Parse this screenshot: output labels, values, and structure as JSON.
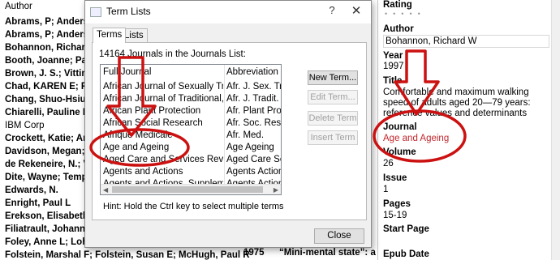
{
  "background_list": {
    "header": "Author",
    "rows": [
      {
        "text": "Abrams, P; Andersso",
        "bold": true
      },
      {
        "text": "Abrams, P; Anders",
        "bold": true
      },
      {
        "text": "Bohannon, Richard W",
        "bold": true
      },
      {
        "text": "Booth, Joanne; Paul,",
        "bold": true
      },
      {
        "text": "Brown, J. S.; Vittingh",
        "bold": true
      },
      {
        "text": "Chad, KAREN E; Reed",
        "bold": true
      },
      {
        "text": "Chang, Shuo-Hsiu J; N",
        "bold": true
      },
      {
        "text": "Chiarelli, Pauline E; M",
        "bold": true
      },
      {
        "text": "IBM Corp",
        "bold": false
      },
      {
        "text": "Crockett, Katie; Arde",
        "bold": true
      },
      {
        "text": "Davidson, Megan; de",
        "bold": true
      },
      {
        "text": "de Rekeneire, N.; Vis",
        "bold": true
      },
      {
        "text": "Dite, Wayne; Temple",
        "bold": true
      },
      {
        "text": "Edwards, N.",
        "bold": true
      },
      {
        "text": "Enright, Paul L",
        "bold": true
      },
      {
        "text": "Erekson, Elisabeth A;",
        "bold": true
      },
      {
        "text": "Filiatrault, Johanne; C",
        "bold": true
      },
      {
        "text": "Foley, Anne L; Loharu",
        "bold": true
      },
      {
        "text": "Folstein, Marshal F; Folstein, Susan E; McHugh, Paul R",
        "bold": true
      }
    ],
    "last_row_year": "1975",
    "last_row_title": "“Mini-mental state”: a"
  },
  "right_panel": {
    "rating_label": "Rating",
    "rating_stars": "•••••",
    "author_label": "Author",
    "author_value": "Bohannon, Richard W",
    "year_label": "Year",
    "year_value": "1997",
    "title_label": "Title",
    "title_line1": "Comfortable and maximum walking",
    "title_line2": "speed of adults aged 20—79 years:",
    "title_line3": "reference values and determinants",
    "journal_label": "Journal",
    "journal_value": "Age and Ageing",
    "volume_label": "Volume",
    "volume_value": "26",
    "issue_label": "Issue",
    "issue_value": "1",
    "pages_label": "Pages",
    "pages_value": "15-19",
    "start_page_label": "Start Page",
    "epub_date_label": "Epub Date",
    "journal_color": "#c0272d"
  },
  "dialog": {
    "title": "Term Lists",
    "help_glyph": "?",
    "close_glyph": "✕",
    "tabs": [
      "Terms",
      "Lists"
    ],
    "count_label": "14164 Journals in the Journals List:",
    "columns": [
      "Full Journal",
      "Abbreviation 1"
    ],
    "rows": [
      {
        "full": "African Journal of Sexually Trans...",
        "abbr": "Afr. J. Sex. Trar"
      },
      {
        "full": "African Journal of Traditional, Co...",
        "abbr": "Afr. J. Tradit. Co"
      },
      {
        "full": "African Plant Protection",
        "abbr": "Afr. Plant Prot."
      },
      {
        "full": "African Social Research",
        "abbr": "Afr. Soc. Res."
      },
      {
        "full": "Afrique Medicale",
        "abbr": "Afr. Med."
      },
      {
        "full": "Age and Ageing",
        "abbr": "Age Ageing"
      },
      {
        "full": "Aged Care and Services Review",
        "abbr": "Aged Care Serv."
      },
      {
        "full": "Agents and Actions",
        "abbr": "Agents Actions"
      },
      {
        "full": "Agents and Actions. Supplements",
        "abbr": "Agents Actions S"
      }
    ],
    "buttons": {
      "new_term": "New Term...",
      "edit_term": "Edit Term...",
      "delete_term": "Delete Term",
      "insert_term": "Insert Term"
    },
    "hint": "Hint: Hold the Ctrl key to select multiple terms",
    "close_label": "Close"
  },
  "annotation_color": "#cc1111"
}
